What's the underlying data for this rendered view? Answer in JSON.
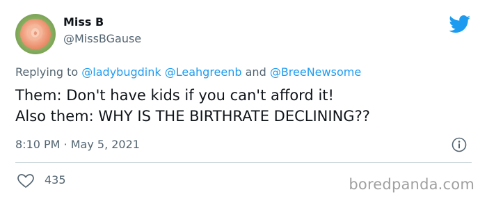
{
  "author": {
    "display_name": "Miss B",
    "handle": "@MissBGause"
  },
  "reply_context": {
    "prefix": "Replying to ",
    "mentions": [
      "@ladybugdink",
      "@Leahgreenb",
      "@BreeNewsome"
    ],
    "separator_1": " ",
    "separator_2": " and "
  },
  "tweet": {
    "line_1": "Them: Don't have kids if you can't afford it!",
    "line_2": "Also them: WHY IS THE BIRTHRATE DECLINING??",
    "time": "8:10 PM",
    "dot": " · ",
    "date": "May 5, 2021"
  },
  "engagement": {
    "likes": "435"
  },
  "watermark": "boredpanda.com",
  "colors": {
    "twitter_blue": "#1d9bf0",
    "secondary_text": "#536471",
    "primary_text": "#0f1419"
  },
  "icons": {
    "platform": "twitter-bird-icon",
    "info": "info-icon",
    "like": "heart-icon"
  }
}
